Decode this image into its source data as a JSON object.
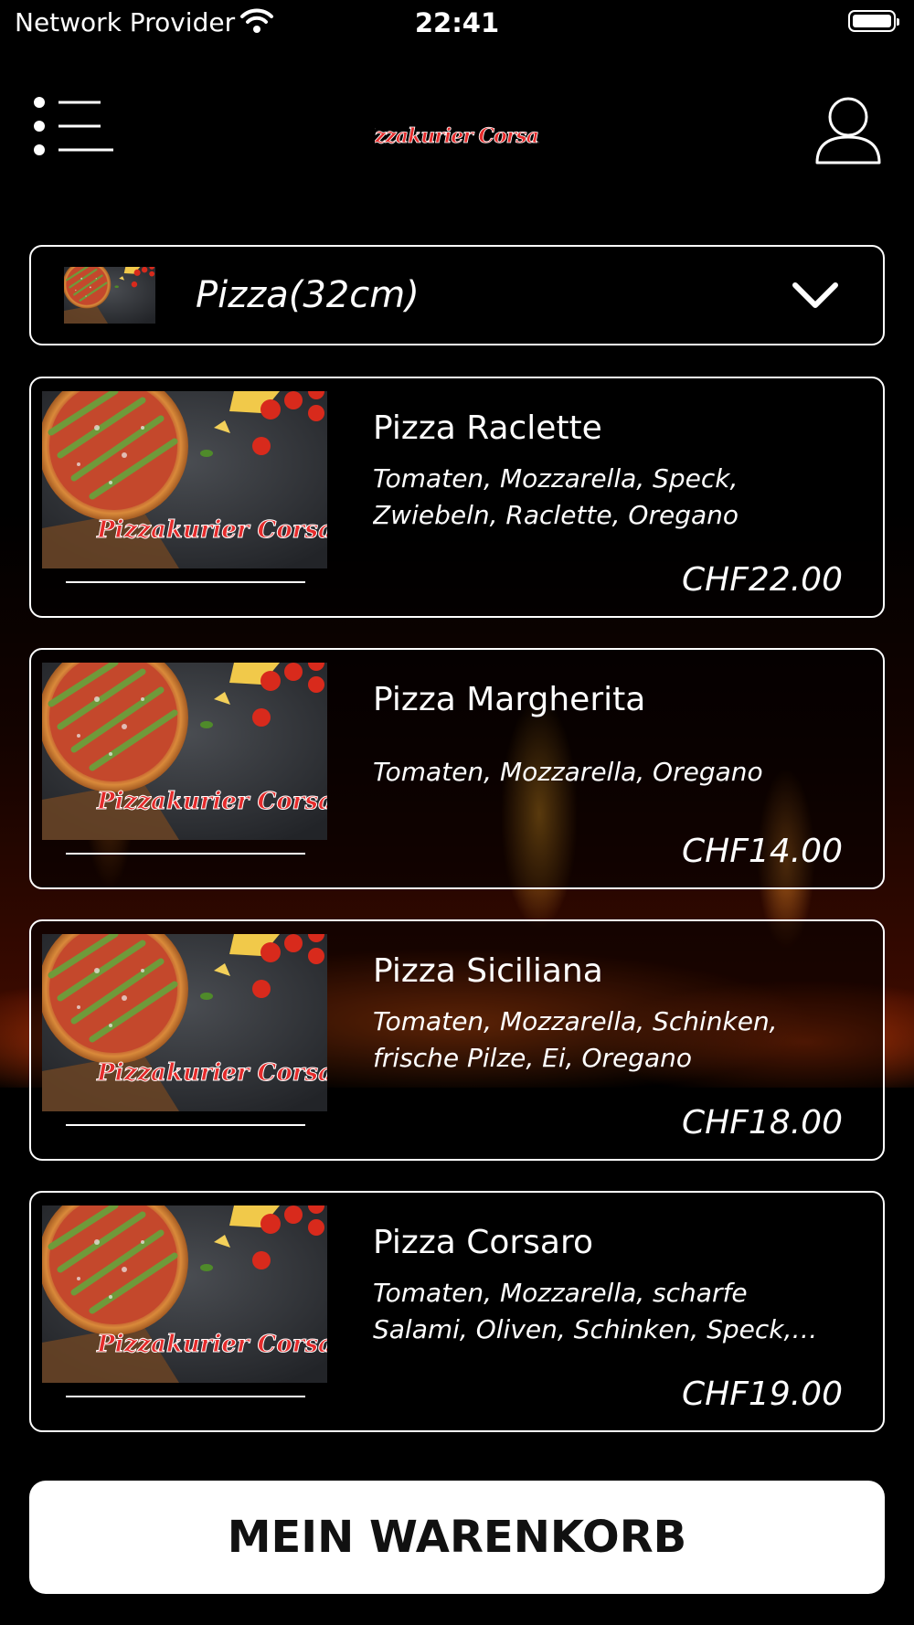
{
  "status_bar": {
    "carrier": "Network Provider",
    "time": "22:41",
    "icons": [
      "wifi-icon",
      "battery-icon"
    ]
  },
  "header": {
    "menu_icon": "list-menu-icon",
    "logo_text": "Pizzakurier Corsaro",
    "user_icon": "user-profile-icon"
  },
  "category": {
    "selected": "Pizza(32cm)",
    "icon": "chevron-down-icon"
  },
  "products": [
    {
      "name": "Pizza Raclette",
      "description": "Tomaten, Mozzarella, Speck, Zwiebeln, Raclette, Oregano",
      "price": "CHF22.00",
      "image_logo": "Pizzakurier Corsaro"
    },
    {
      "name": "Pizza Margherita",
      "description": "Tomaten, Mozzarella, Oregano",
      "price": "CHF14.00",
      "image_logo": "Pizzakurier Corsaro"
    },
    {
      "name": "Pizza Siciliana",
      "description": "Tomaten, Mozzarella, Schinken, frische Pilze, Ei, Oregano",
      "price": "CHF18.00",
      "image_logo": "Pizzakurier Corsaro"
    },
    {
      "name": "Pizza Corsaro",
      "description": "Tomaten, Mozzarella, scharfe Salami, Oliven, Schinken, Speck, Zwiebeln, Or...",
      "price": "CHF19.00",
      "image_logo": "Pizzakurier Corsaro"
    }
  ],
  "cart_button": {
    "label": "MEIN WARENKORB"
  },
  "colors": {
    "background": "#000000",
    "card_border": "#ffffff",
    "logo_red": "#e52b2b",
    "cart_bg": "#ffffff",
    "cart_text": "#111111"
  }
}
